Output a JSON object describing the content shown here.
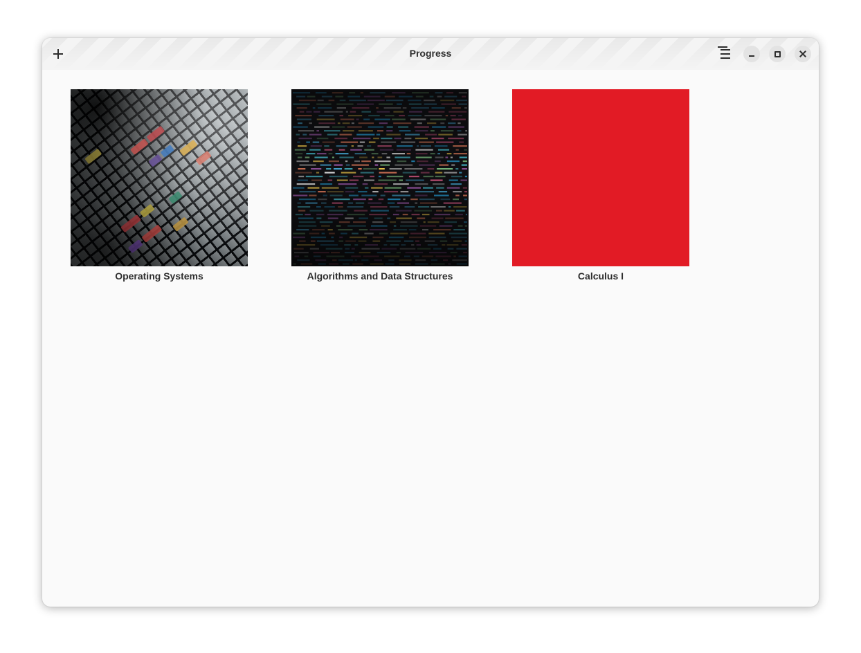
{
  "window": {
    "title": "Progress"
  },
  "header": {
    "add_icon": "plus-icon",
    "menu_icon": "hamburger-menu-icon",
    "minimize_icon": "minimize-icon",
    "maximize_icon": "maximize-icon",
    "close_icon": "close-icon"
  },
  "courses": [
    {
      "name": "Operating Systems",
      "cover": "keyboard-photo"
    },
    {
      "name": "Algorithms and Data Structures",
      "cover": "code-photo"
    },
    {
      "name": "Calculus I",
      "cover": "solid-color",
      "color": "#e21b25"
    }
  ]
}
